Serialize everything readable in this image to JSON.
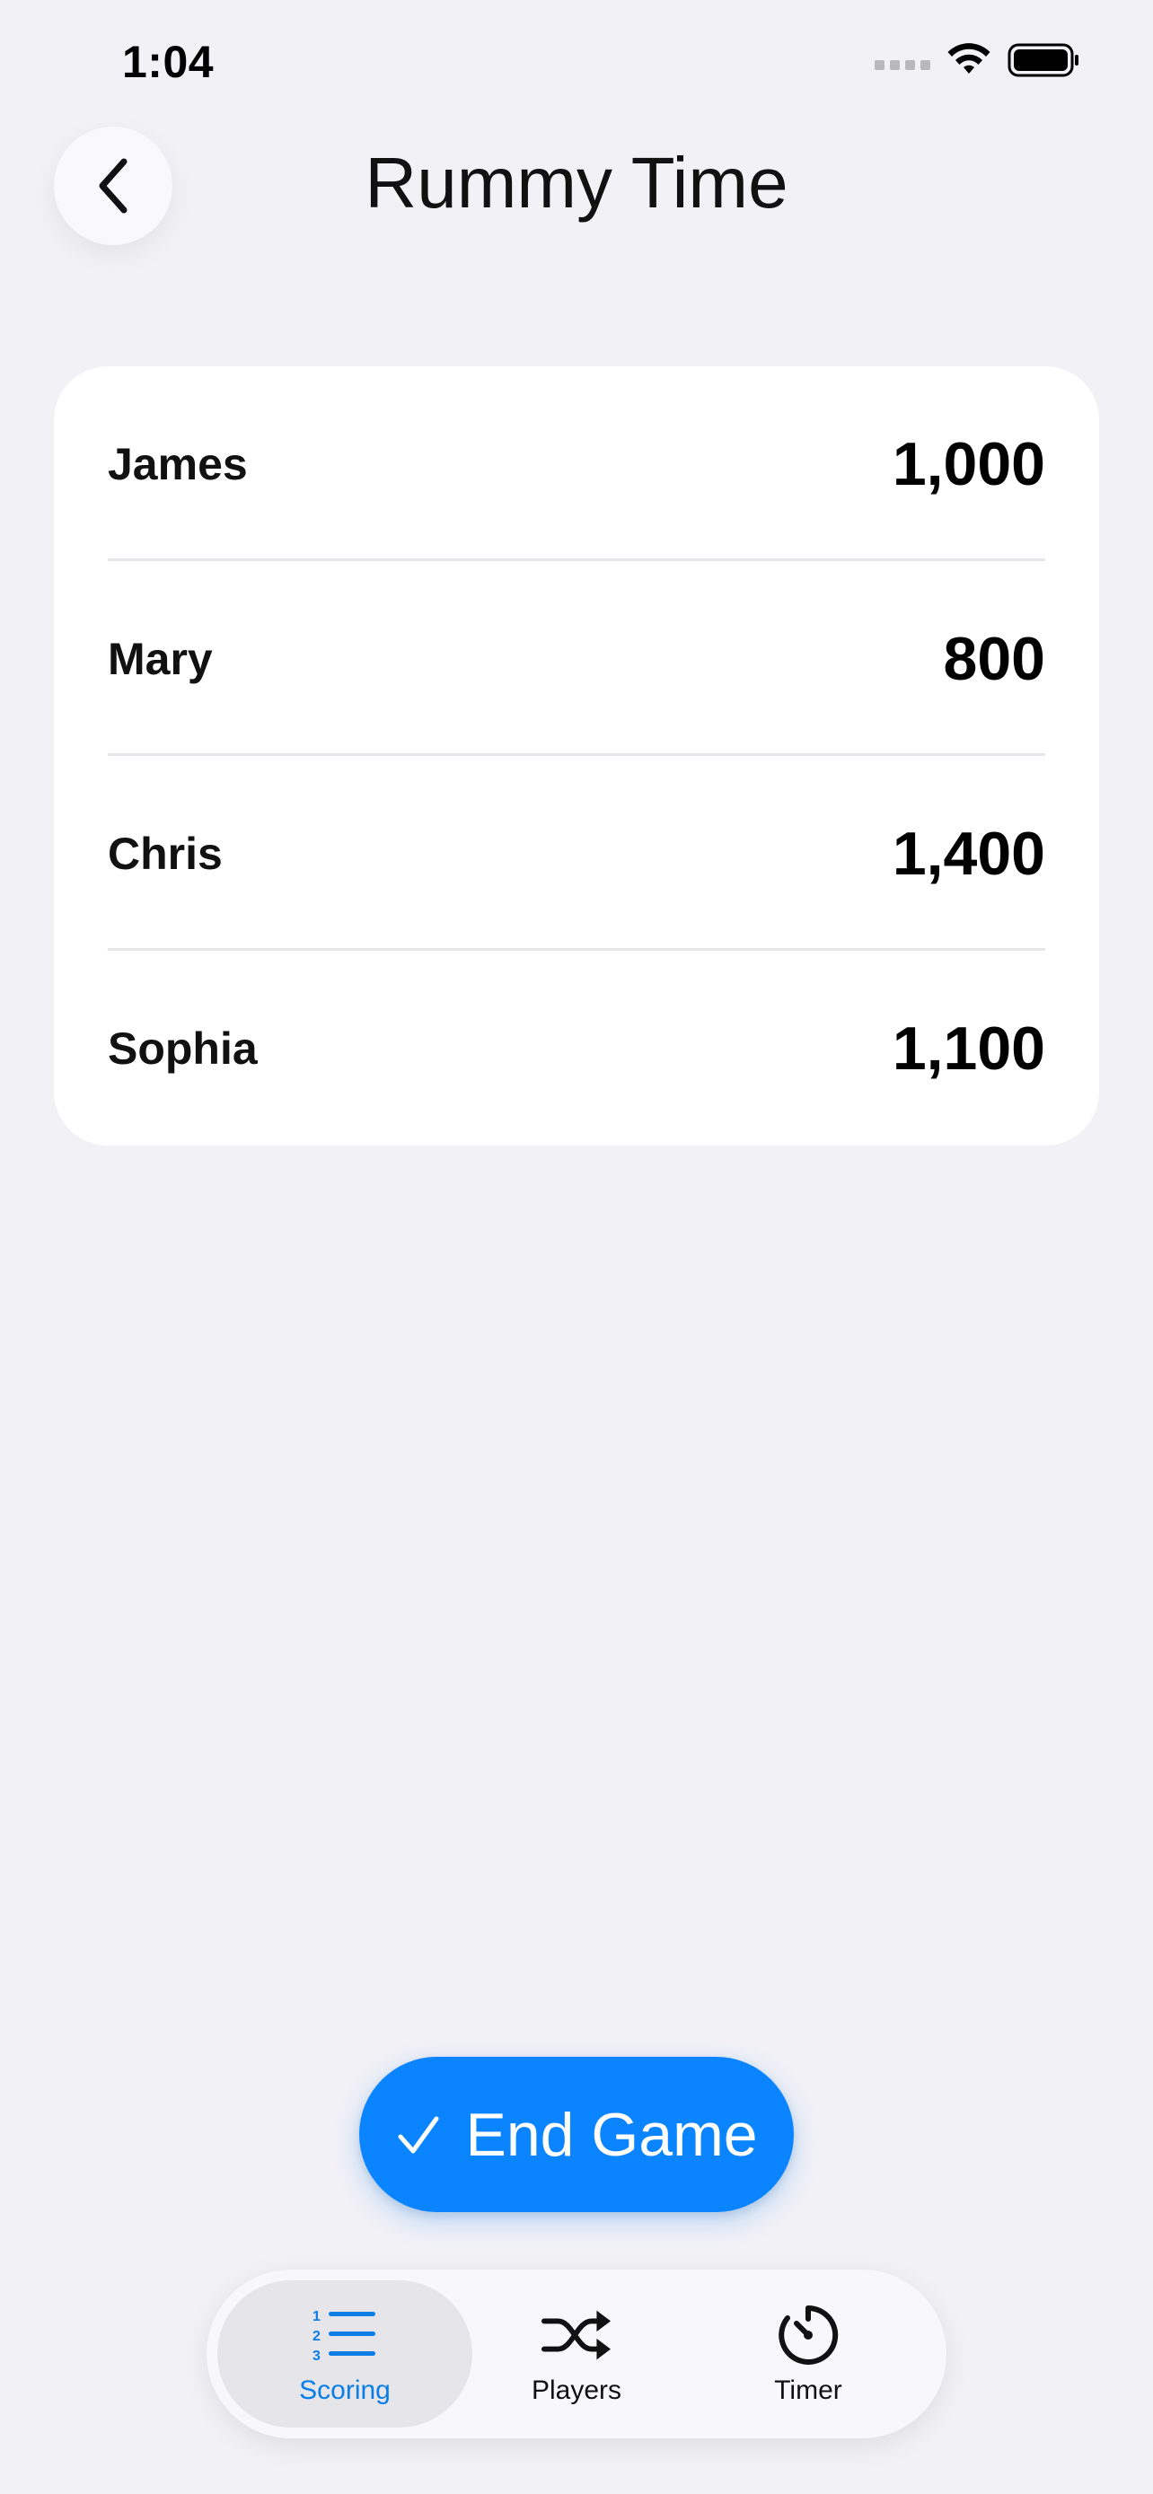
{
  "status_bar": {
    "time": "1:04"
  },
  "header": {
    "title": "Rummy Time"
  },
  "players": [
    {
      "name": "James",
      "score": "1,000"
    },
    {
      "name": "Mary",
      "score": "800"
    },
    {
      "name": "Chris",
      "score": "1,400"
    },
    {
      "name": "Sophia",
      "score": "1,100"
    }
  ],
  "actions": {
    "end_game_label": "End Game",
    "end_game_icon": "checkmark-icon"
  },
  "tabs": [
    {
      "label": "Scoring",
      "icon": "numbered-list-icon",
      "active": true
    },
    {
      "label": "Players",
      "icon": "shuffle-icon",
      "active": false
    },
    {
      "label": "Timer",
      "icon": "timer-icon",
      "active": false
    }
  ],
  "colors": {
    "accent": "#0a84ff",
    "background": "#f1f1f6",
    "card": "#ffffff"
  }
}
